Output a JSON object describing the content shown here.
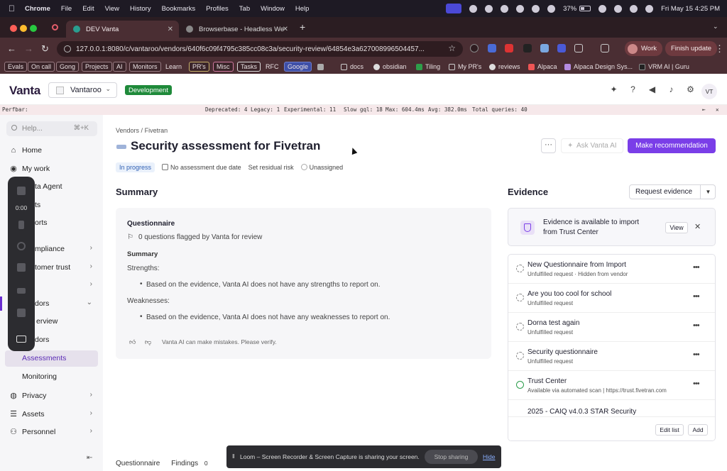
{
  "menubar": {
    "app": "Chrome",
    "items": [
      "File",
      "Edit",
      "View",
      "History",
      "Bookmarks",
      "Profiles",
      "Tab",
      "Window",
      "Help"
    ],
    "battery": "37%",
    "datetime": "Fri May 15  4:25 PM"
  },
  "tabs": [
    {
      "label": "DEV Vanta",
      "active": true
    },
    {
      "label": "Browserbase - Headless Web",
      "active": false
    }
  ],
  "address": {
    "url": "127.0.0.1:8080/c/vantaroo/vendors/640f6c09f4795c385cc08c3a/security-review/64854e3a627008996504457...",
    "profile": "Work",
    "update": "Finish update"
  },
  "bookmarks": [
    "Evals",
    "On call",
    "Gong",
    "Projects",
    "AI",
    "Monitors",
    "Learn",
    "PR's",
    "Misc",
    "Tasks",
    "RFC",
    "Google",
    "docs",
    "obsidian",
    "Tiling",
    "My PR's",
    "reviews",
    "Alpaca",
    "Alpaca Design Sys...",
    "VRM AI | Guru"
  ],
  "header": {
    "logo": "Vanta",
    "org": "Vantaroo",
    "env_badge": "Development",
    "avatar": "VT"
  },
  "perfbar": {
    "label": "Perfbar:",
    "deprecated": "Deprecated: 4",
    "legacy": "Legacy: 1",
    "experimental": "Experimental: 11",
    "slow": "Slow gql: 18",
    "max": "Max: 604.4ms",
    "avg": "Avg: 382.0ms",
    "total": "Total queries: 40"
  },
  "sidebar": {
    "search_placeholder": "Help...",
    "shortcut": "⌘+K",
    "items": [
      {
        "label": "Home"
      },
      {
        "label": "My work"
      },
      {
        "label": "ta Agent"
      },
      {
        "label": "ts"
      },
      {
        "label": "orts"
      },
      {
        "label": "mpliance"
      },
      {
        "label": "tomer trust"
      },
      {
        "label": ""
      },
      {
        "label": "dors"
      },
      {
        "label": "erview"
      },
      {
        "label": "dors"
      },
      {
        "label": "Assessments"
      },
      {
        "label": "Monitoring"
      },
      {
        "label": "Privacy"
      },
      {
        "label": "Assets"
      },
      {
        "label": "Personnel"
      }
    ]
  },
  "loom": {
    "time": "0:00"
  },
  "breadcrumb": {
    "parent": "Vendors",
    "sep": "/",
    "current": "Fivetran"
  },
  "page": {
    "title": "Security assessment for Fivetran",
    "ask_ai": "Ask Vanta AI",
    "make_recommendation": "Make recommendation",
    "more": "···"
  },
  "status": {
    "state": "In progress",
    "due": "No assessment due date",
    "residual": "Set residual risk",
    "assignee": "Unassigned"
  },
  "summary": {
    "heading": "Summary",
    "questionnaire": "Questionnaire",
    "flagged": "0 questions flagged by Vanta for review",
    "sub": "Summary",
    "strengths_label": "Strengths:",
    "strengths": "Based on the evidence, Vanta AI does not have any strengths to report on.",
    "weaknesses_label": "Weaknesses:",
    "weaknesses": "Based on the evidence, Vanta AI does not have any weaknesses to report on.",
    "disclaimer": "Vanta AI can make mistakes. Please verify."
  },
  "evidence": {
    "heading": "Evidence",
    "request": "Request evidence",
    "banner": "Evidence is available to import from Trust Center",
    "view": "View",
    "items": [
      {
        "title": "New Questionnaire from Import",
        "sub": "Unfulfilled request · Hidden from vendor"
      },
      {
        "title": "Are you too cool for school",
        "sub": "Unfulfilled request"
      },
      {
        "title": "Dorna test again",
        "sub": "Unfulfilled request"
      },
      {
        "title": "Security questionnaire",
        "sub": "Unfulfilled request"
      },
      {
        "title": "Trust Center",
        "sub": "Available via automated scan | https://trust.fivetran.com"
      },
      {
        "title": "2025 - CAIQ v4.0.3 STAR Security",
        "sub": ""
      }
    ],
    "edit": "Edit list",
    "add": "Add"
  },
  "bottom_tabs": {
    "questionnaire": "Questionnaire",
    "findings": "Findings",
    "findings_count": "0"
  },
  "sharebar": {
    "message": "Loom – Screen Recorder & Screen Capture is sharing your screen.",
    "stop": "Stop sharing",
    "hide": "Hide"
  }
}
